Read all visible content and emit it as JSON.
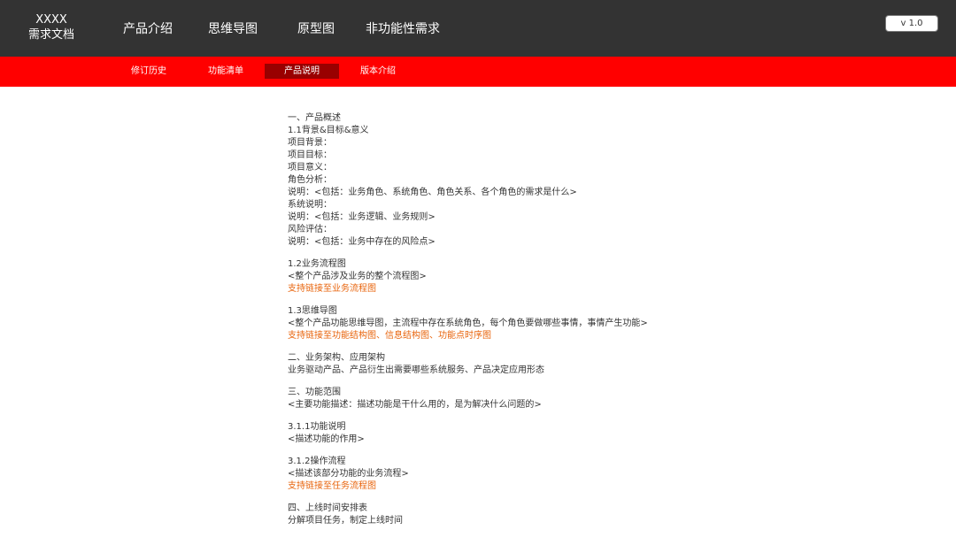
{
  "header": {
    "logo_line1": "XXXX",
    "logo_line2": "需求文档",
    "nav": [
      "产品介绍",
      "思维导图",
      "原型图",
      "非功能性需求"
    ],
    "version_label": "v 1.0"
  },
  "subnav": {
    "items": [
      "修订历史",
      "功能清单",
      "产品说明",
      "版本介绍"
    ],
    "active_index": 2
  },
  "colors": {
    "topbar": "#333333",
    "subbar": "#ff0000",
    "subnav_active": "#990000",
    "link": "#e8640c",
    "text": "#333333"
  },
  "content": {
    "block1": [
      "一、产品概述",
      "1.1背景&目标&意义",
      "项目背景：",
      "项目目标：",
      "项目意义：",
      "角色分析：",
      "说明：<包括：业务角色、系统角色、角色关系、各个角色的需求是什么>",
      "系统说明：",
      "说明：<包括：业务逻辑、业务规则>",
      "风险评估：",
      "说明：<包括：业务中存在的风险点>"
    ],
    "block2": {
      "title": "1.2业务流程图",
      "desc": "<整个产品涉及业务的整个流程图>",
      "link": "支持链接至业务流程图"
    },
    "block3": {
      "title": "1.3思维导图",
      "desc": "<整个产品功能思维导图，主流程中存在系统角色，每个角色要做哪些事情，事情产生功能>",
      "link": "支持链接至功能结构图、信息结构图、功能点时序图"
    },
    "block4": {
      "title": "二、业务架构、应用架构",
      "desc": "业务驱动产品、产品衍生出需要哪些系统服务、产品决定应用形态"
    },
    "block5": {
      "title": "三、功能范围",
      "desc": "<主要功能描述：描述功能是干什么用的，是为解决什么问题的>"
    },
    "block6": {
      "title": "3.1.1功能说明",
      "desc": "<描述功能的作用>"
    },
    "block7": {
      "title": "3.1.2操作流程",
      "desc": "<描述该部分功能的业务流程>",
      "link": "支持链接至任务流程图"
    },
    "block8": {
      "title": "四、上线时间安排表",
      "desc": "分解项目任务，制定上线时间"
    }
  }
}
